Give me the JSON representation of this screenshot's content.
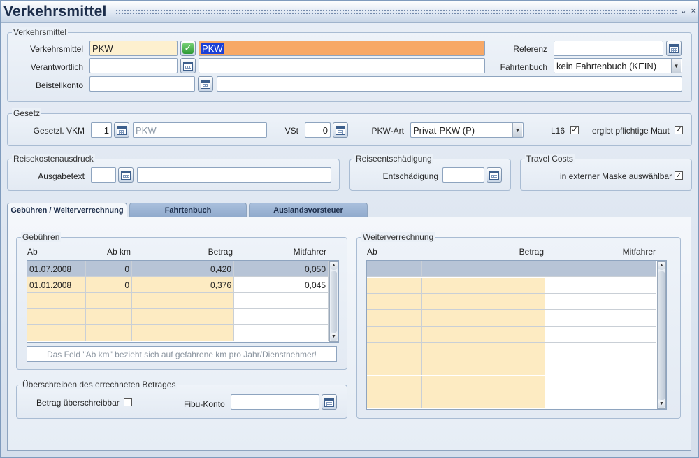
{
  "window": {
    "title": "Verkehrsmittel",
    "controls": {
      "restore": "⌄",
      "close": "×"
    }
  },
  "group_verkehrsmittel": {
    "legend": "Verkehrsmittel",
    "verkehrsmittel_label": "Verkehrsmittel",
    "verkehrsmittel_code": "PKW",
    "verkehrsmittel_name": "PKW",
    "verantwortlich_label": "Verantwortlich",
    "verantwortlich_code": "",
    "verantwortlich_name": "",
    "beistellkonto_label": "Beistellkonto",
    "beistellkonto_code": "",
    "beistellkonto_name": "",
    "referenz_label": "Referenz",
    "referenz_value": "",
    "fahrtenbuch_label": "Fahrtenbuch",
    "fahrtenbuch_value": "kein Fahrtenbuch (KEIN)"
  },
  "group_gesetz": {
    "legend": "Gesetz",
    "vkm_label": "Gesetzl. VKM",
    "vkm_value": "1",
    "vkm_name": "PKW",
    "vst_label": "VSt",
    "vst_value": "0",
    "pkwart_label": "PKW-Art",
    "pkwart_value": "Privat-PKW (P)",
    "l16_label": "L16",
    "maut_label": "ergibt pflichtige Maut",
    "check_mark": "✓"
  },
  "group_reisekosten": {
    "legend": "Reisekostenausdruck",
    "ausgabetext_label": "Ausgabetext",
    "ausgabetext_code": "",
    "ausgabetext_value": ""
  },
  "group_reiseentschaedigung": {
    "legend": "Reiseentschädigung",
    "entschaedigung_label": "Entschädigung",
    "entschaedigung_value": ""
  },
  "group_travel": {
    "legend": "Travel Costs",
    "extern_label": "in externer Maske auswählbar"
  },
  "tabs": [
    {
      "label": "Gebühren / Weiterverrechnung"
    },
    {
      "label": "Fahrtenbuch"
    },
    {
      "label": "Auslandsvorsteuer"
    }
  ],
  "gebuehren": {
    "legend": "Gebühren",
    "headers": [
      "Ab",
      "Ab km",
      "Betrag",
      "Mitfahrer"
    ],
    "rows": [
      [
        "01.07.2008",
        "0",
        "0,420",
        "0,050"
      ],
      [
        "01.01.2008",
        "0",
        "0,376",
        "0,045"
      ]
    ],
    "hint": "Das Feld \"Ab km\" bezieht sich auf gefahrene km pro Jahr/Dienstnehmer!"
  },
  "weiterverrechnung": {
    "legend": "Weiterverrechnung",
    "headers": [
      "Ab",
      "Betrag",
      "Mitfahrer"
    ]
  },
  "ueberschreiben": {
    "legend": "Überschreiben des errechneten Betrages",
    "betrag_label": "Betrag überschreibbar",
    "fibu_label": "Fibu-Konto",
    "fibu_value": ""
  },
  "scroll_arrows": {
    "up": "▲",
    "down": "▼"
  },
  "dropdown_arrow": "▼"
}
